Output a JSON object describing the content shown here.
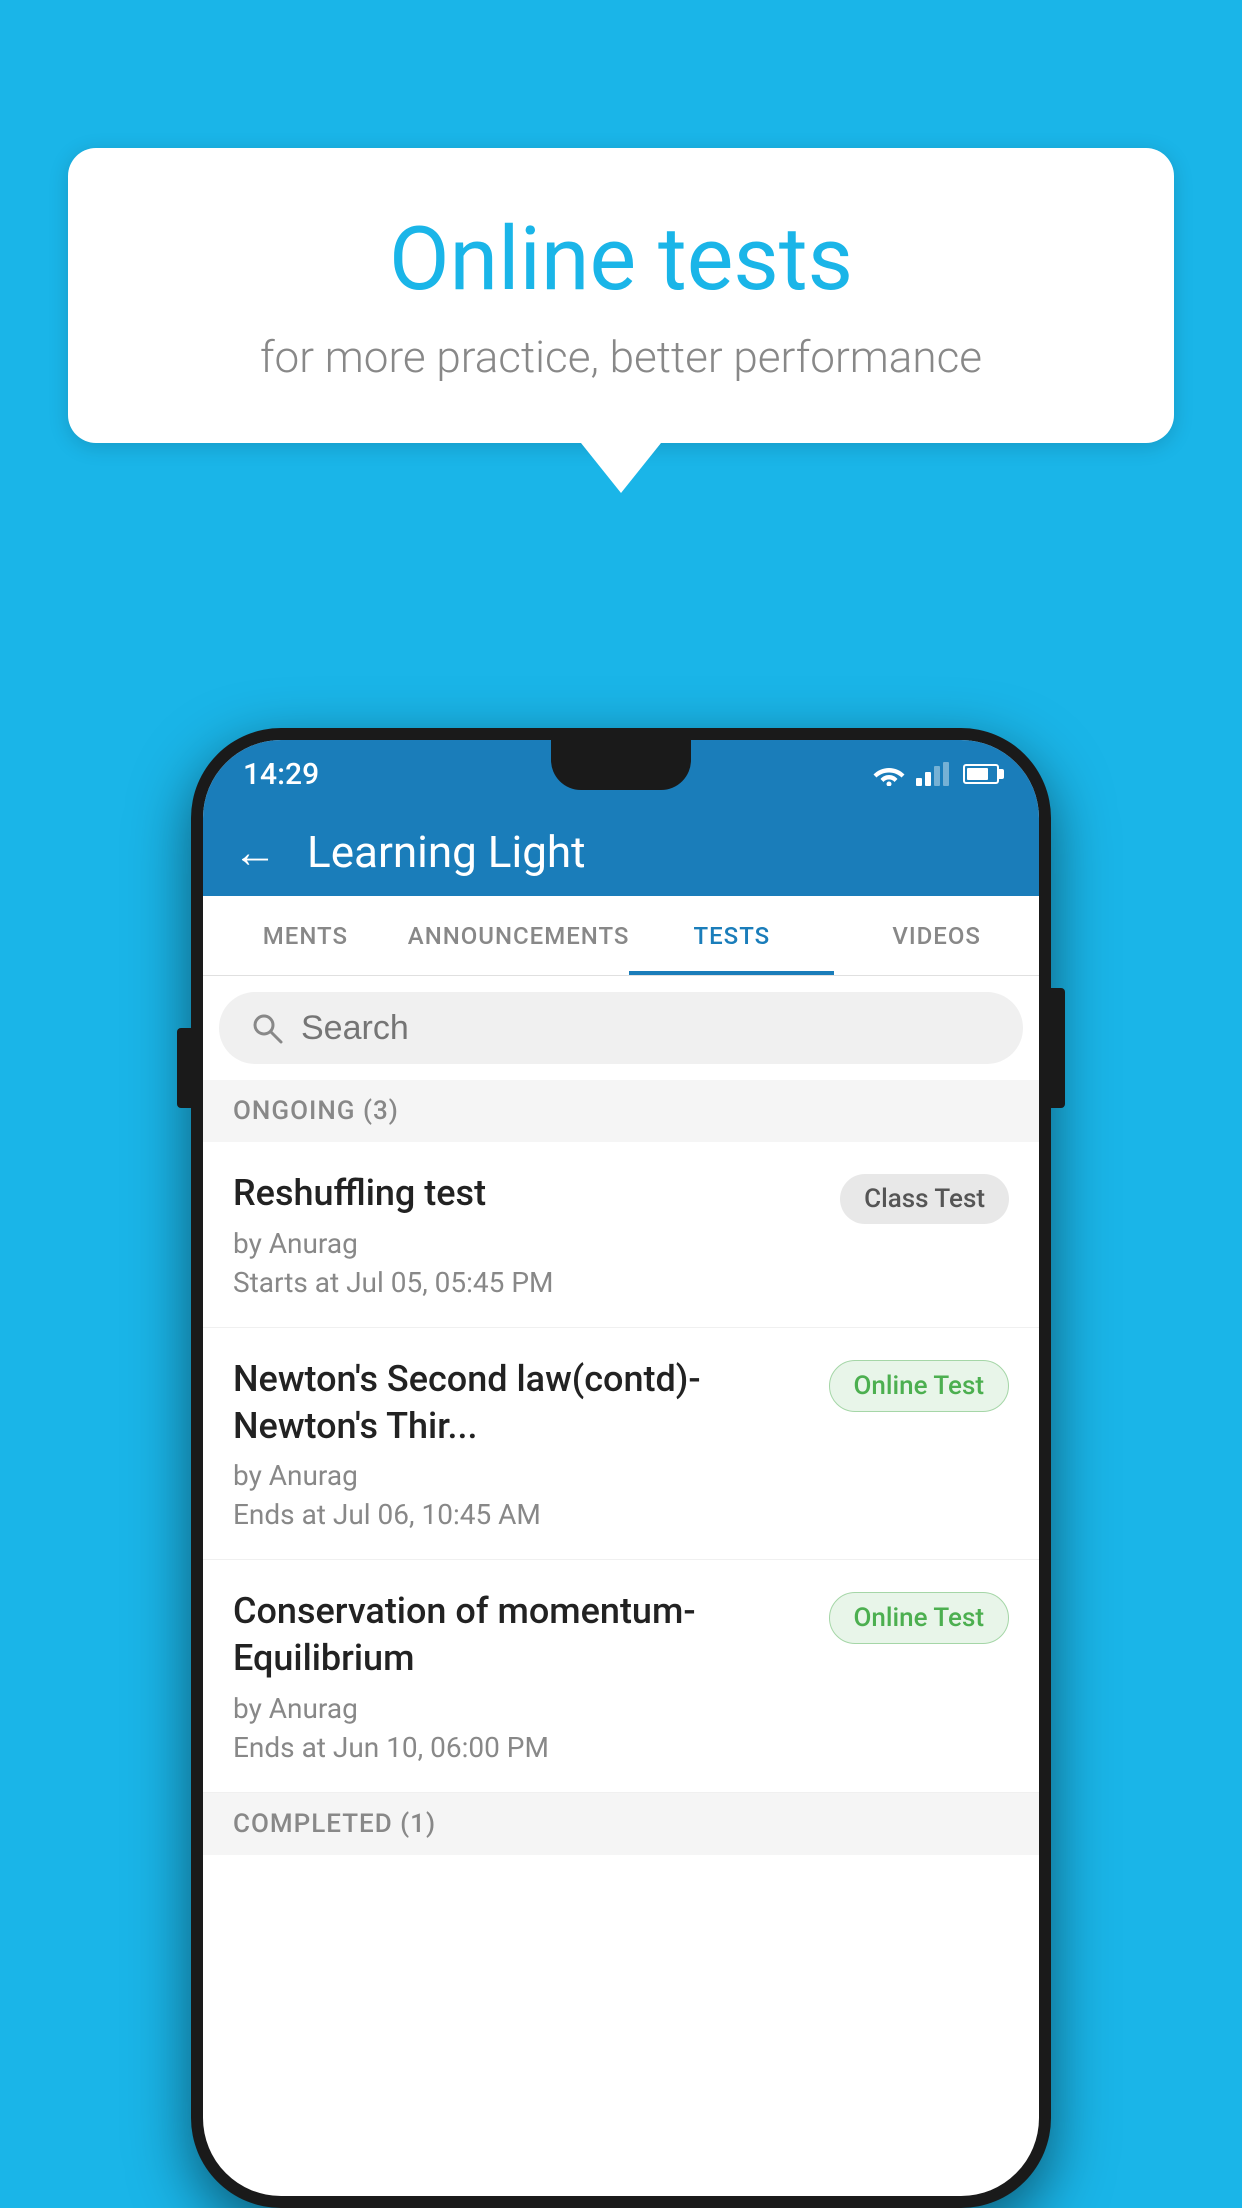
{
  "background": {
    "color": "#1ab5e8"
  },
  "speech_bubble": {
    "title": "Online tests",
    "subtitle": "for more practice, better performance"
  },
  "phone": {
    "status_bar": {
      "time": "14:29"
    },
    "header": {
      "back_label": "←",
      "title": "Learning Light"
    },
    "tabs": [
      {
        "label": "MENTS",
        "active": false
      },
      {
        "label": "ANNOUNCEMENTS",
        "active": false
      },
      {
        "label": "TESTS",
        "active": true
      },
      {
        "label": "VIDEOS",
        "active": false
      }
    ],
    "search": {
      "placeholder": "Search"
    },
    "ongoing_section": {
      "label": "ONGOING (3)"
    },
    "tests": [
      {
        "title": "Reshuffling test",
        "by": "by Anurag",
        "date": "Starts at  Jul 05, 05:45 PM",
        "badge": "Class Test",
        "badge_type": "class"
      },
      {
        "title": "Newton's Second law(contd)-Newton's Thir...",
        "by": "by Anurag",
        "date": "Ends at  Jul 06, 10:45 AM",
        "badge": "Online Test",
        "badge_type": "online"
      },
      {
        "title": "Conservation of momentum-Equilibrium",
        "by": "by Anurag",
        "date": "Ends at  Jun 10, 06:00 PM",
        "badge": "Online Test",
        "badge_type": "online"
      }
    ],
    "completed_section": {
      "label": "COMPLETED (1)"
    }
  }
}
